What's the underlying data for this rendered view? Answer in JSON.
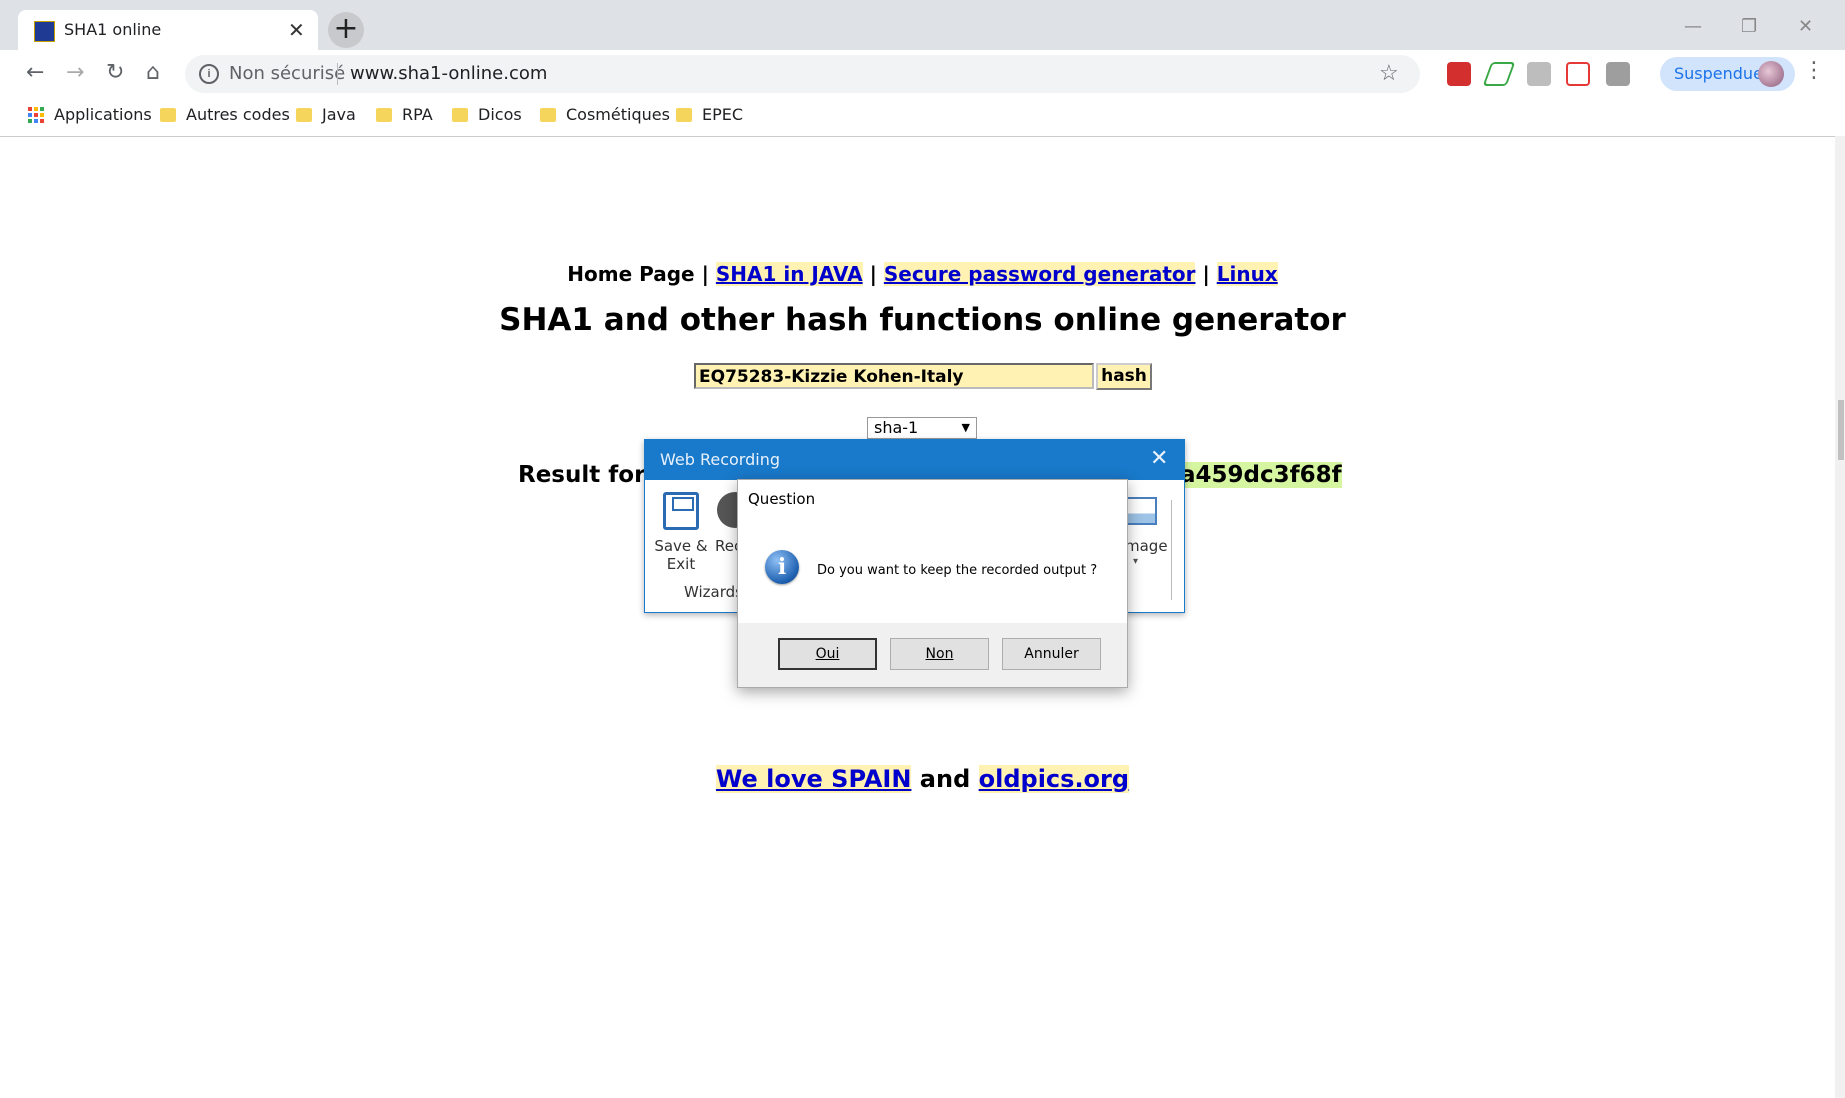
{
  "browser": {
    "tab_title": "SHA1 online",
    "tab_close": "✕",
    "new_tab": "+",
    "window_controls": {
      "minimize": "—",
      "restore": "❐",
      "close": "✕"
    },
    "nav": {
      "back": "←",
      "forward": "→",
      "reload": "↻",
      "home": "⌂"
    },
    "omnibox": {
      "info": "i",
      "security": "Non sécurisé",
      "url": "www.sha1-online.com",
      "star": "☆"
    },
    "profile": {
      "label": "Suspendue"
    },
    "menu": "⋮",
    "extensions": [
      {
        "name": "adblock-icon",
        "color": "#d32f2f"
      },
      {
        "name": "activity-icon",
        "color": "#3aa845"
      },
      {
        "name": "extension-gray-icon",
        "color": "#bdbdbd"
      },
      {
        "name": "pocket-icon",
        "color": "#e53935"
      },
      {
        "name": "uipath-icon",
        "color": "#9e9e9e"
      }
    ],
    "bookmarks": [
      "Applications",
      "Autres codes",
      "Java",
      "RPA",
      "Dicos",
      "Cosmétiques",
      "EPEC"
    ]
  },
  "page": {
    "nav": {
      "home": "Home Page",
      "sep": "|",
      "link1": "SHA1 in JAVA",
      "link2": "Secure password generator",
      "link3": "Linux"
    },
    "heading": "SHA1 and other hash functions online generator",
    "input_value": "EQ75283-Kizzie Kohen-Italy",
    "hash_button": "hash",
    "algorithm": "sha-1",
    "algorithm_arrow": "▼",
    "result_label": "Result for",
    "result_hash_visible": "a459dc3f68f",
    "footer": {
      "link1": "We love SPAIN",
      "and": "and",
      "link2": "oldpics.org"
    }
  },
  "web_recording": {
    "title": "Web Recording",
    "close": "✕",
    "save_label": "Save & Exit",
    "rec_label": "Rec",
    "wizards_label": "Wizards",
    "image_label": "mage",
    "image_dropdown": "▾"
  },
  "question_dialog": {
    "title": "Question",
    "icon": "i",
    "message": "Do you want to keep the recorded output ?",
    "buttons": {
      "yes": "Oui",
      "no": "Non",
      "cancel": "Annuler"
    }
  }
}
